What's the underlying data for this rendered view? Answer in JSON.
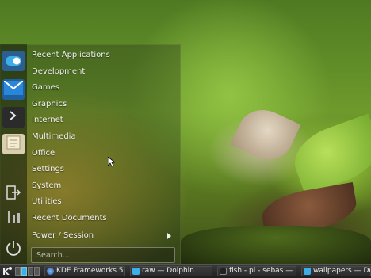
{
  "launcher": {
    "sidebar_icons": [
      "settings-toggle-icon",
      "mail-icon",
      "terminal-icon",
      "notes-icon",
      "logout-icon",
      "tools-icon",
      "power-icon"
    ],
    "menu_items": [
      "Recent Applications",
      "Development",
      "Games",
      "Graphics",
      "Internet",
      "Multimedia",
      "Office",
      "Settings",
      "System",
      "Utilities",
      "Recent Documents"
    ],
    "power_label": "Power / Session",
    "search_placeholder": "Search..."
  },
  "taskbar": {
    "start_icon": "kde-logo-icon",
    "tasks": [
      {
        "label": "KDE Frameworks 5",
        "icon": "browser-icon"
      },
      {
        "label": "raw — Dolphin",
        "icon": "folder-icon"
      },
      {
        "label": "fish - pi - sebas —",
        "icon": "terminal-icon"
      },
      {
        "label": "wallpapers — Do",
        "icon": "folder-icon"
      }
    ]
  },
  "colors": {
    "accent": "#3daee9",
    "menu_text": "#f2f2f2",
    "taskbar_bg": "#262626"
  }
}
